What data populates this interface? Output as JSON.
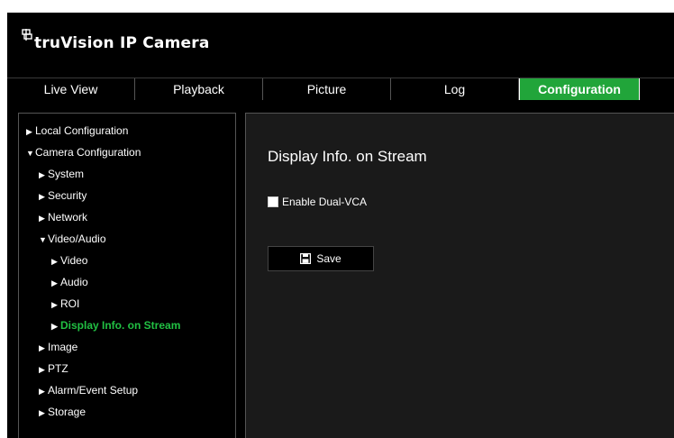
{
  "app": {
    "title": "truVision IP Camera",
    "accent_color": "#21a53a"
  },
  "nav": {
    "tabs": [
      {
        "label": "Live View"
      },
      {
        "label": "Playback"
      },
      {
        "label": "Picture"
      },
      {
        "label": "Log"
      },
      {
        "label": "Configuration",
        "active": true
      }
    ]
  },
  "sidebar": {
    "items": [
      {
        "label": "Local Configuration",
        "expanded": false
      },
      {
        "label": "Camera Configuration",
        "expanded": true
      },
      {
        "label": "System",
        "expanded": false
      },
      {
        "label": "Security",
        "expanded": false
      },
      {
        "label": "Network",
        "expanded": false
      },
      {
        "label": "Video/Audio",
        "expanded": true
      },
      {
        "label": "Video",
        "expanded": false
      },
      {
        "label": "Audio",
        "expanded": false
      },
      {
        "label": "ROI",
        "expanded": false
      },
      {
        "label": "Display Info. on Stream",
        "expanded": false,
        "active": true
      },
      {
        "label": "Image",
        "expanded": false
      },
      {
        "label": "PTZ",
        "expanded": false
      },
      {
        "label": "Alarm/Event Setup",
        "expanded": false
      },
      {
        "label": "Storage",
        "expanded": false
      }
    ]
  },
  "main": {
    "title": "Display Info. on Stream",
    "enable_dual_vca": {
      "label": "Enable Dual-VCA",
      "checked": false
    },
    "save_label": "Save"
  }
}
